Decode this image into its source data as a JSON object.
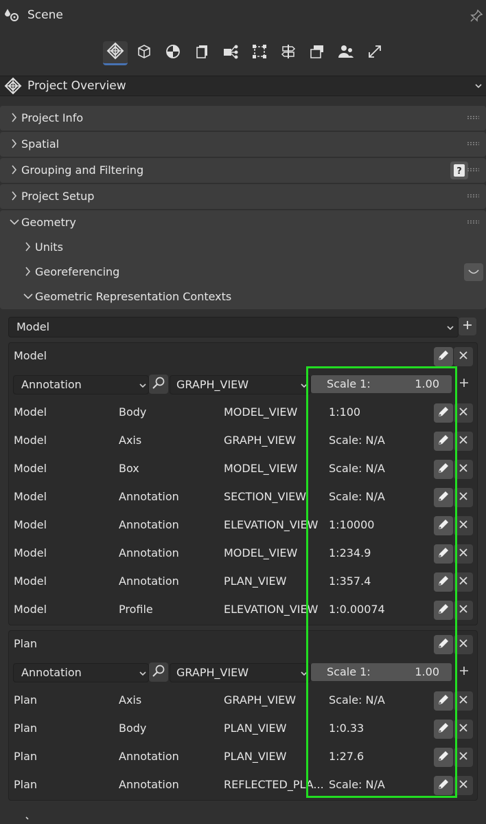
{
  "header": {
    "title": "Scene"
  },
  "tabs": [
    {
      "icon": "bim-logo-icon",
      "active": true
    },
    {
      "icon": "cube-icon"
    },
    {
      "icon": "material-sphere-icon"
    },
    {
      "icon": "layers-icon"
    },
    {
      "icon": "nodes-icon"
    },
    {
      "icon": "grid-select-icon"
    },
    {
      "icon": "signpost-icon"
    },
    {
      "icon": "stack-icon"
    },
    {
      "icon": "users-icon"
    },
    {
      "icon": "arrows-icon"
    }
  ],
  "project_dropdown": {
    "label": "Project Overview"
  },
  "panels": {
    "project_info": "Project Info",
    "spatial": "Spatial",
    "grouping": "Grouping and Filtering",
    "project_setup": "Project Setup",
    "geometry": "Geometry",
    "units": "Units",
    "georeferencing": "Georeferencing",
    "grc": "Geometric Representation Contexts"
  },
  "context_select": {
    "value": "Model"
  },
  "model_block": {
    "title": "Model",
    "filter": {
      "subcontext": "Annotation",
      "target_view": "GRAPH_VIEW",
      "scale_label": "Scale 1:",
      "scale_value": "1.00"
    },
    "rows": [
      {
        "c": "Model",
        "s": "Body",
        "v": "MODEL_VIEW",
        "scale": "1:100"
      },
      {
        "c": "Model",
        "s": "Axis",
        "v": "GRAPH_VIEW",
        "scale": "Scale: N/A"
      },
      {
        "c": "Model",
        "s": "Box",
        "v": "MODEL_VIEW",
        "scale": "Scale: N/A"
      },
      {
        "c": "Model",
        "s": "Annotation",
        "v": "SECTION_VIEW",
        "scale": "Scale: N/A"
      },
      {
        "c": "Model",
        "s": "Annotation",
        "v": "ELEVATION_VIEW",
        "scale": "1:10000"
      },
      {
        "c": "Model",
        "s": "Annotation",
        "v": "MODEL_VIEW",
        "scale": "1:234.9"
      },
      {
        "c": "Model",
        "s": "Annotation",
        "v": "PLAN_VIEW",
        "scale": "1:357.4"
      },
      {
        "c": "Model",
        "s": "Profile",
        "v": "ELEVATION_VIEW",
        "scale": "1:0.00074"
      }
    ]
  },
  "plan_block": {
    "title": "Plan",
    "filter": {
      "subcontext": "Annotation",
      "target_view": "GRAPH_VIEW",
      "scale_label": "Scale 1:",
      "scale_value": "1.00"
    },
    "rows": [
      {
        "c": "Plan",
        "s": "Axis",
        "v": "GRAPH_VIEW",
        "scale": "Scale: N/A"
      },
      {
        "c": "Plan",
        "s": "Body",
        "v": "PLAN_VIEW",
        "scale": "1:0.33"
      },
      {
        "c": "Plan",
        "s": "Annotation",
        "v": "PLAN_VIEW",
        "scale": "1:27.6"
      },
      {
        "c": "Plan",
        "s": "Annotation",
        "v": "REFLECTED_PLA...",
        "scale": "Scale: N/A"
      }
    ]
  },
  "colors": {
    "background": "#303030",
    "panel": "#3d3d3d",
    "accent": "#4772b3",
    "highlight": "#22dd22"
  }
}
